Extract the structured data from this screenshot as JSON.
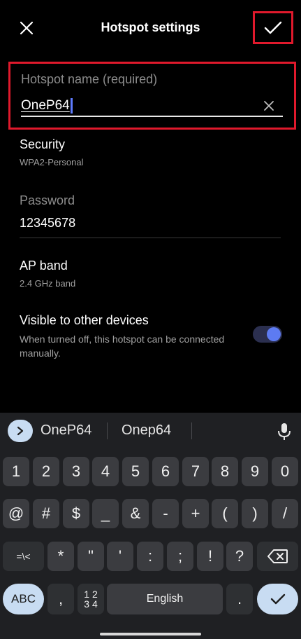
{
  "header": {
    "title": "Hotspot settings"
  },
  "hotspot_name": {
    "label": "Hotspot name (required)",
    "value": "OneP64"
  },
  "security": {
    "title": "Security",
    "value": "WPA2-Personal"
  },
  "password": {
    "label": "Password",
    "value": "12345678"
  },
  "ap_band": {
    "title": "AP band",
    "value": "2.4 GHz band"
  },
  "visible": {
    "title": "Visible to other devices",
    "description": "When turned off, this hotspot can be connected manually.",
    "enabled": true
  },
  "keyboard": {
    "suggestions": [
      "OneP64",
      "Onep64"
    ],
    "row1": [
      "1",
      "2",
      "3",
      "4",
      "5",
      "6",
      "7",
      "8",
      "9",
      "0"
    ],
    "row2": [
      "@",
      "#",
      "$",
      "_",
      "&",
      "-",
      "+",
      "(",
      ")",
      "/"
    ],
    "row3": [
      "=\\<",
      "*",
      "\"",
      "'",
      ":",
      ";",
      "!",
      "?"
    ],
    "abc_label": "ABC",
    "comma": ",",
    "numpad_label": "1 2\n3 4",
    "space_label": "English",
    "period": "."
  },
  "colors": {
    "highlight_border": "#e0192c",
    "accent": "#5d7bf2",
    "key_bg": "#3b3c40",
    "keyboard_bg": "#1f2023",
    "action_key_bg": "#c8dcf2"
  }
}
